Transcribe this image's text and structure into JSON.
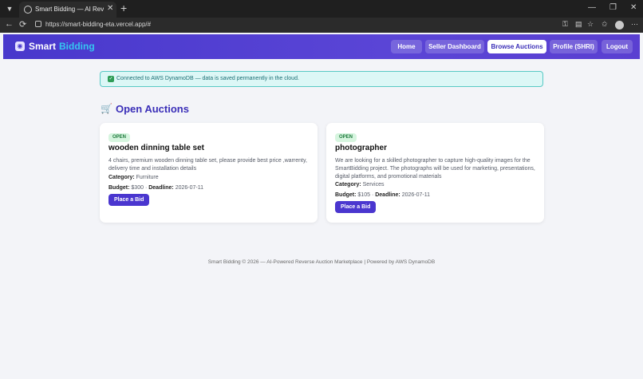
{
  "browser": {
    "tab_title": "Smart Bidding — AI Reverse Auction",
    "url": "https://smart-bidding-eta.vercel.app/#",
    "tab_close": "✕",
    "tab_new": "+",
    "back": "←",
    "reload": "⟳",
    "minimize": "—",
    "maximize": "❐",
    "close": "✕",
    "more": "⋯"
  },
  "navbar": {
    "brand_primary": "Smart",
    "brand_accent": "Bidding",
    "items": [
      {
        "label": "Home",
        "active": false
      },
      {
        "label": "Seller Dashboard",
        "active": false
      },
      {
        "label": "Browse Auctions",
        "active": true
      },
      {
        "label": "Profile (SHRI)",
        "active": false
      },
      {
        "label": "Logout",
        "active": false
      }
    ]
  },
  "alert": {
    "text": "Connected to AWS DynamoDB — data is saved permanently in the cloud."
  },
  "section": {
    "title": "Open Auctions"
  },
  "auctions": [
    {
      "status": "OPEN",
      "title": "wooden dinning table set",
      "description": "4 chairs, premium wooden dinning table set, please provide best price ,warrenty, delivery time and installation details",
      "category_label": "Category:",
      "category": "Furniture",
      "budget_label": "Budget:",
      "budget": "$300",
      "separator": "·",
      "deadline_label": "Deadline:",
      "deadline": "2026-07-11",
      "action": "Place a Bid"
    },
    {
      "status": "OPEN",
      "title": "photographer",
      "description": "We are looking for a skilled photographer to capture high-quality images for the SmartBidding project. The photographs will be used for marketing, presentations, digital platforms, and promotional materials",
      "category_label": "Category:",
      "category": "Services",
      "budget_label": "Budget:",
      "budget": "$105",
      "separator": "·",
      "deadline_label": "Deadline:",
      "deadline": "2026-07-11",
      "action": "Place a Bid"
    }
  ],
  "footer": {
    "text": "Smart Bidding © 2026 — AI-Powered Reverse Auction Marketplace | Powered by AWS DynamoDB"
  },
  "colors": {
    "brand_primary": "#4838cc",
    "brand_accent": "#35c6f0",
    "open_badge": "#d6f5df",
    "alert_bg": "#dcf7f6"
  }
}
